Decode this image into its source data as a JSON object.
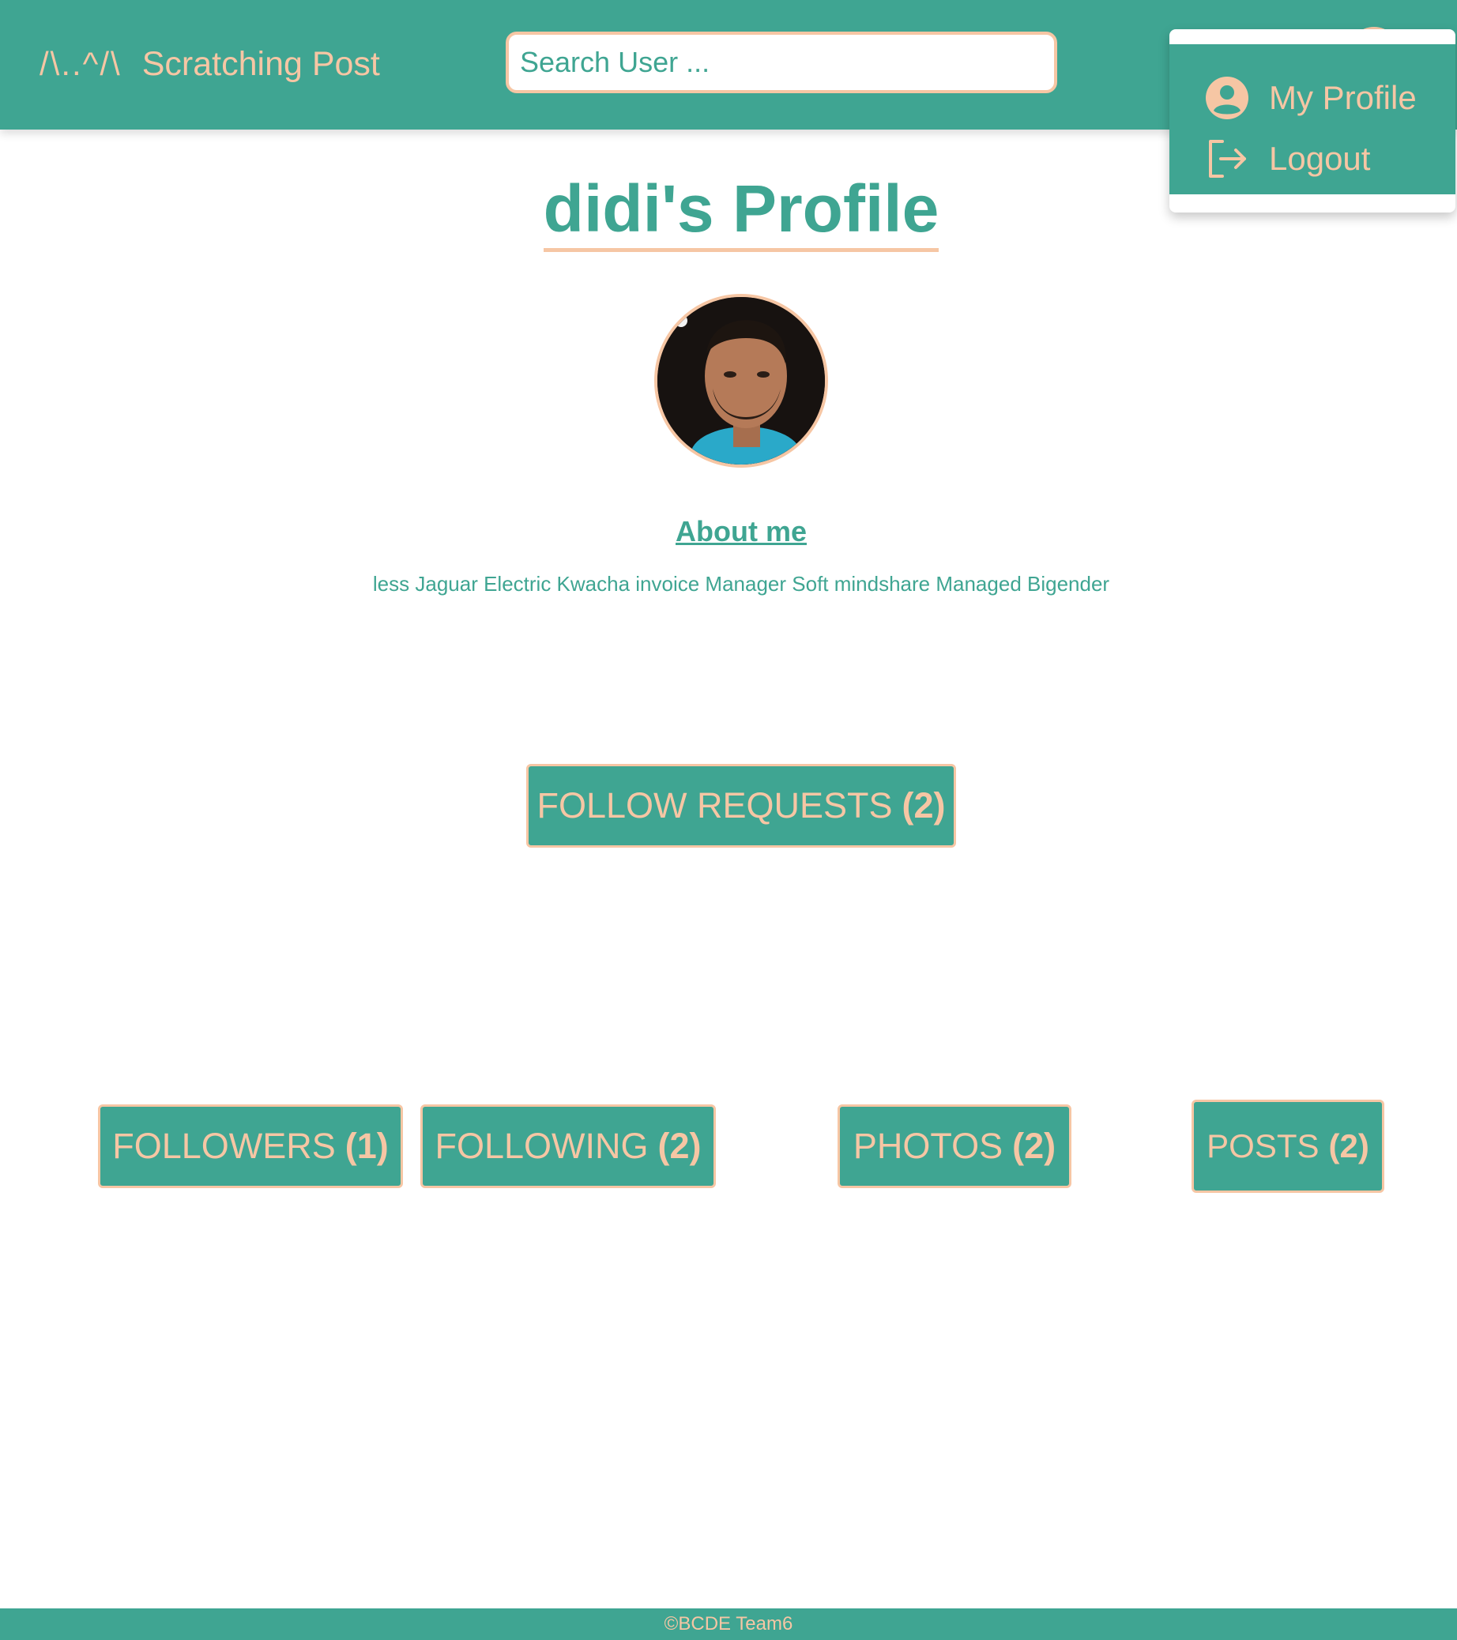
{
  "navbar": {
    "brand_logo": "/\\..^/\\",
    "brand_name": "Scratching Post",
    "search_placeholder": "Search User ..."
  },
  "dropdown": {
    "items": [
      {
        "label": "My Profile",
        "icon": "user-circle-icon"
      },
      {
        "label": "Logout",
        "icon": "logout-icon"
      }
    ]
  },
  "profile": {
    "title": "didi's Profile",
    "about_heading": "About me",
    "about_text": "less Jaguar Electric Kwacha invoice Manager Soft mindshare Managed Bigender"
  },
  "buttons": {
    "follow_requests": {
      "label": "FOLLOW REQUESTS",
      "count": "(2)"
    },
    "followers": {
      "label": "FOLLOWERS",
      "count": "(1)"
    },
    "following": {
      "label": "FOLLOWING",
      "count": "(2)"
    },
    "photos": {
      "label": "PHOTOS",
      "count": "(2)"
    },
    "posts": {
      "label": "POSTS",
      "count": "(2)"
    }
  },
  "footer": {
    "text": "©BCDE Team6"
  },
  "colors": {
    "primary": "#3fa592",
    "accent": "#f6c6a4"
  }
}
